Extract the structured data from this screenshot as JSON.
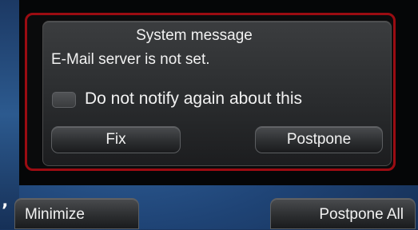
{
  "dialog": {
    "title": "System message",
    "message": "E-Mail server is not set.",
    "checkbox_label": "Do not notify again about this",
    "checkbox_checked": false,
    "fix_label": "Fix",
    "postpone_label": "Postpone"
  },
  "footer": {
    "minimize_label": "Minimize",
    "postpone_all_label": "Postpone All"
  },
  "fragment_mark": "’",
  "colors": {
    "alert_border": "#9b0c12",
    "background_blue": "#1f4476",
    "panel_black": "#050607",
    "text": "#f2f2f2"
  }
}
